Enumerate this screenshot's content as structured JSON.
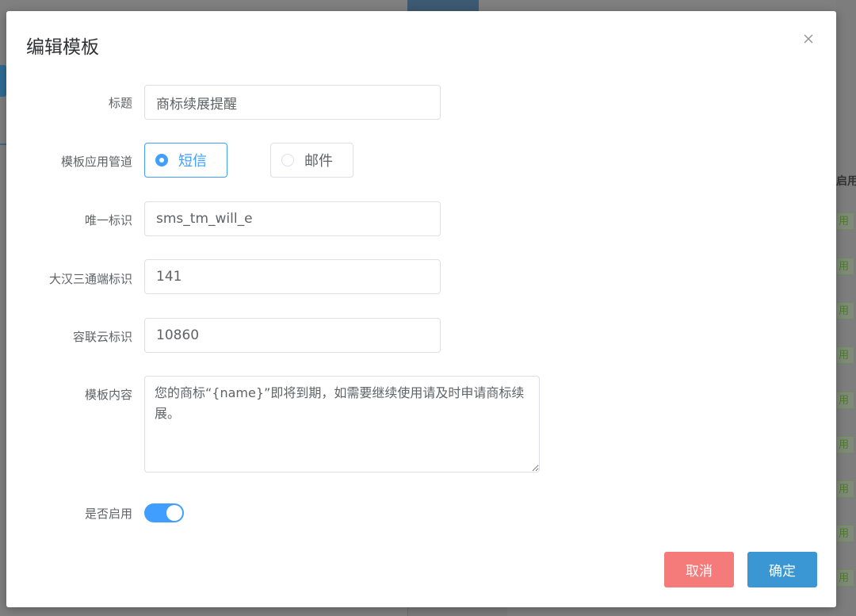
{
  "dialog": {
    "title": "编辑模板"
  },
  "form": {
    "title": {
      "label": "标题",
      "value": "商标续展提醒"
    },
    "channel": {
      "label": "模板应用管道",
      "options": [
        {
          "label": "短信",
          "checked": true
        },
        {
          "label": "邮件",
          "checked": false
        }
      ]
    },
    "unique_id": {
      "label": "唯一标识",
      "value": "sms_tm_will_e"
    },
    "dahan_id": {
      "label": "大汉三通端标识",
      "value": "141"
    },
    "ronglian_id": {
      "label": "容联云标识",
      "value": "10860"
    },
    "content": {
      "label": "模板内容",
      "value": "您的商标“{name}”即将到期，如需要继续使用请及时申请商标续展。"
    },
    "enabled": {
      "label": "是否启用",
      "value": true
    }
  },
  "buttons": {
    "cancel": "取消",
    "confirm": "确定"
  },
  "background": {
    "right_header": "启用",
    "right_cell": "用"
  },
  "colors": {
    "primary": "#409eff",
    "confirm": "#3a97d4",
    "cancel": "#f56c6c"
  },
  "icons": {
    "close": "close-icon"
  }
}
